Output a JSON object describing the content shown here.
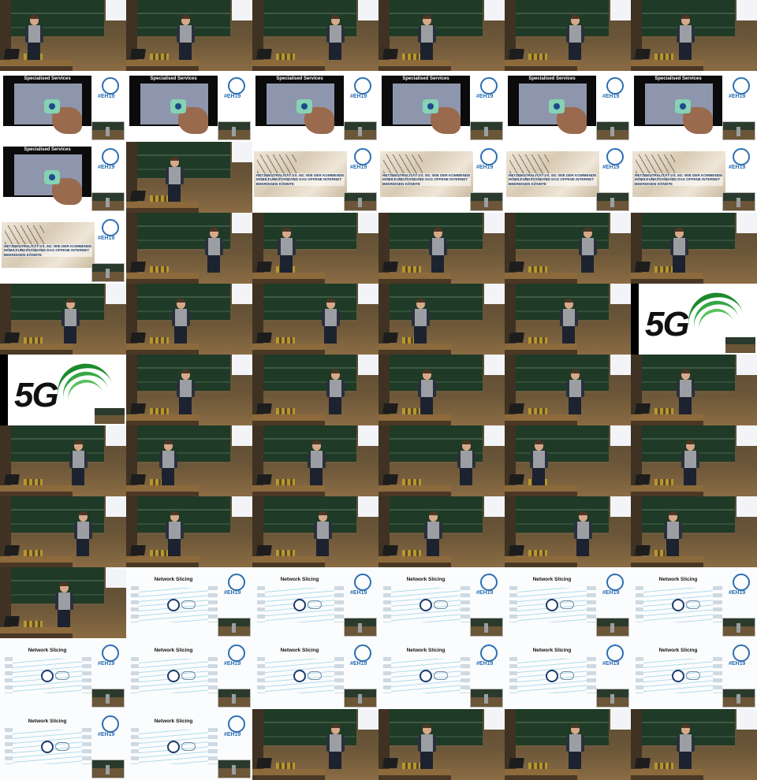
{
  "frames": {
    "services_title": "Specialised Services",
    "neutrality_title": "NETZNEUTRALITÄT VS. 5G: WIE DER KOMMENDE MOBILFUNKSTANDARD DAS OFFENE INTERNET BEERDIGEN KÖNNTE",
    "hashtag": "#EH19",
    "fiveg_text": "5G",
    "slicing_title": "Network Slicing"
  },
  "tiles": [
    "lecture",
    "lecture",
    "lecture",
    "lecture",
    "lecture",
    "lecture",
    "services",
    "services",
    "services",
    "services",
    "services",
    "services",
    "services",
    "lecture",
    "neutrality",
    "neutrality",
    "neutrality",
    "neutrality",
    "neutrality",
    "lecture",
    "lecture",
    "lecture",
    "lecture",
    "lecture",
    "lecture",
    "lecture",
    "lecture",
    "lecture",
    "lecture",
    "fiveg",
    "fiveg",
    "lecture",
    "lecture",
    "lecture",
    "lecture",
    "lecture",
    "lecture",
    "lecture",
    "lecture",
    "lecture",
    "lecture",
    "lecture",
    "lecture",
    "lecture",
    "lecture",
    "lecture",
    "lecture",
    "lecture",
    "lecture",
    "slicing",
    "slicing",
    "slicing",
    "slicing",
    "slicing",
    "slicing",
    "slicing",
    "slicing",
    "slicing",
    "slicing",
    "slicing",
    "slicing",
    "slicing",
    "lecture",
    "lecture",
    "lecture",
    "lecture"
  ]
}
